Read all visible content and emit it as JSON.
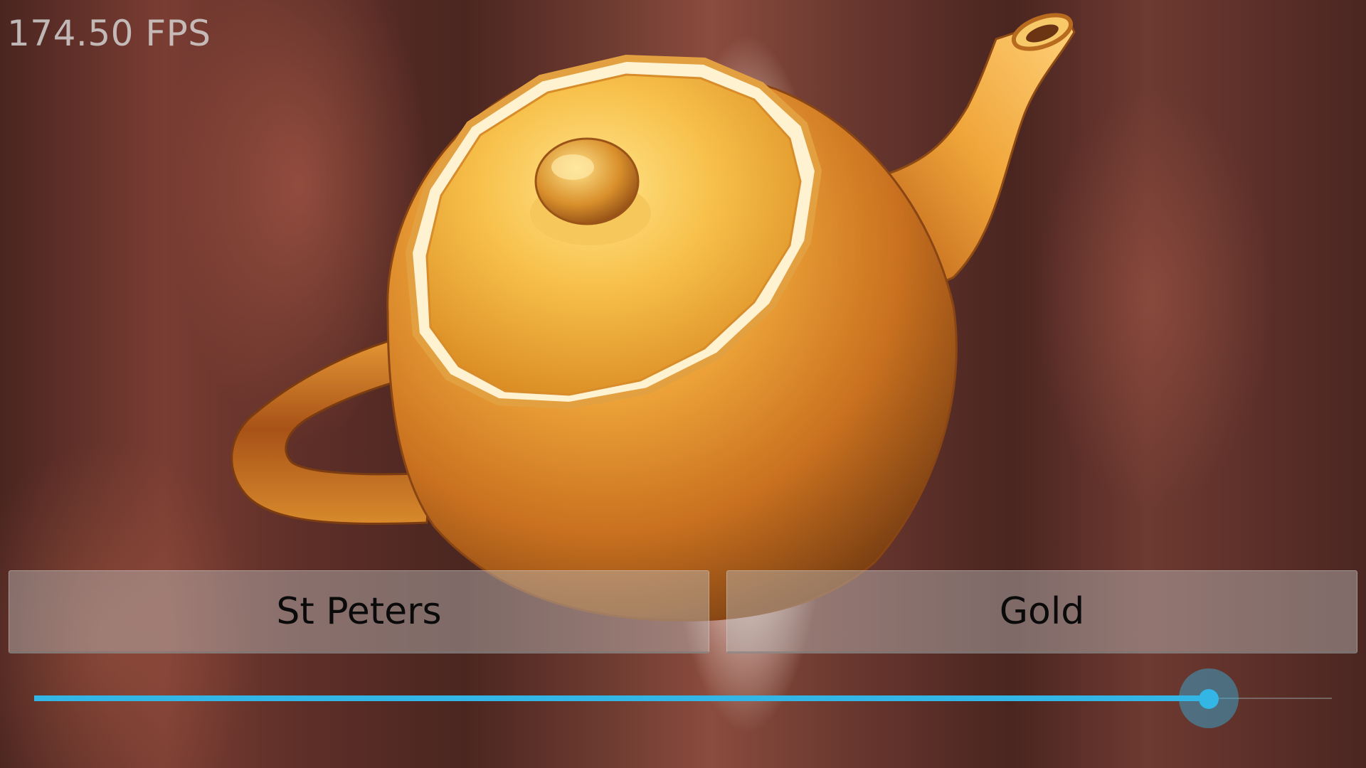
{
  "viewport": {
    "fps_label": "174.50 FPS"
  },
  "controls": {
    "cubemap_button_label": "St Peters",
    "material_button_label": "Gold",
    "slider": {
      "value_fraction": 0.905
    }
  },
  "colors": {
    "accent": "#33b5e5",
    "gold": "#e8a23c"
  }
}
